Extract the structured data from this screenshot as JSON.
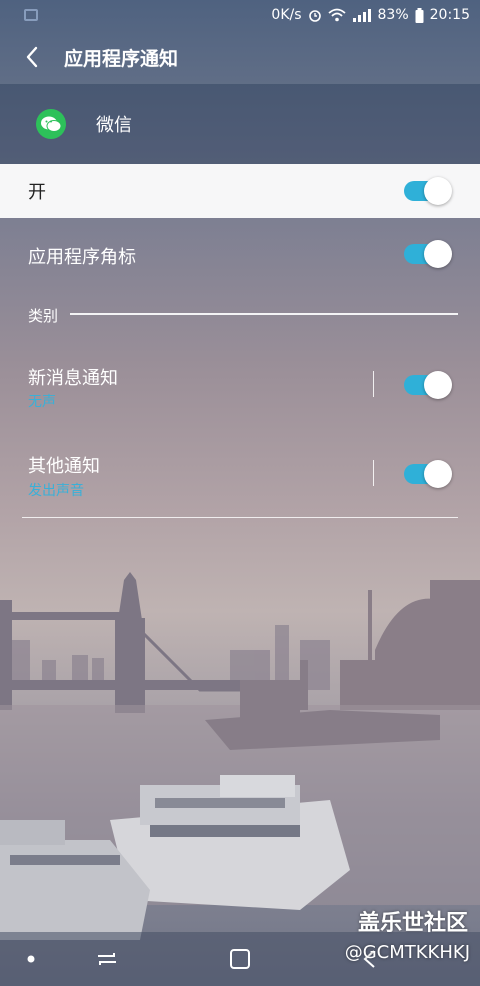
{
  "status_bar": {
    "net_speed": "0K/s",
    "battery": "83%",
    "time": "20:15"
  },
  "header": {
    "title": "应用程序通知"
  },
  "app": {
    "name": "微信",
    "icon": "wechat-icon",
    "icon_color": "#2dc15a"
  },
  "master_switch": {
    "label": "开",
    "on": true
  },
  "badge_setting": {
    "label": "应用程序角标",
    "on": true
  },
  "category": {
    "label": "类别",
    "items": [
      {
        "label": "新消息通知",
        "sub": "无声",
        "on": true
      },
      {
        "label": "其他通知",
        "sub": "发出声音",
        "on": true
      }
    ]
  },
  "accent_color": "#2fb0d8",
  "watermark": {
    "line1": "盖乐世社区",
    "line2": "@GCMTKKHKJ"
  }
}
